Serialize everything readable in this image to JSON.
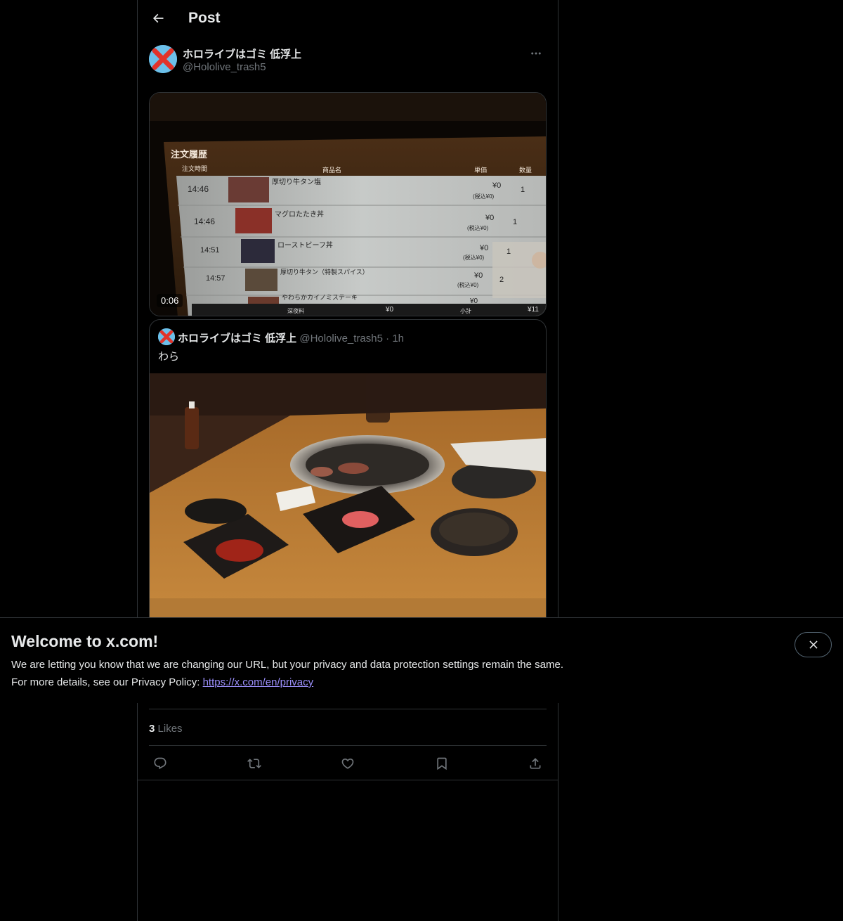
{
  "header": {
    "title": "Post"
  },
  "post": {
    "author_name": "ホロライブはゴミ 低浮上",
    "author_handle": "@Hololive_trash5",
    "video_duration": "0:06",
    "likes_count": "3",
    "likes_label": "Likes"
  },
  "quote": {
    "author_name": "ホロライブはゴミ 低浮上",
    "author_handle": "@Hololive_trash5",
    "separator": "·",
    "time": "1h",
    "text": "わら"
  },
  "video_screen": {
    "panel_title": "注文履歴",
    "col_time": "注文時間",
    "col_item": "商品名",
    "col_price": "単価",
    "col_qty": "数量",
    "rows": [
      {
        "time": "14:46",
        "item": "厚切り牛タン塩",
        "price": "¥0",
        "tax": "(税込¥0)",
        "qty": "1"
      },
      {
        "time": "14:46",
        "item": "マグロたたき丼",
        "price": "¥0",
        "tax": "(税込¥0)",
        "qty": "1"
      },
      {
        "time": "14:51",
        "item": "ローストビーフ丼",
        "price": "¥0",
        "tax": "(税込¥0)",
        "qty": "1"
      },
      {
        "time": "14:57",
        "item": "厚切り牛タン（特製スパイス）",
        "price": "¥0",
        "tax": "(税込¥0)",
        "qty": "2"
      },
      {
        "time": "",
        "item": "やわらかカイノミステーキ",
        "price": "¥0",
        "tax": "",
        "qty": ""
      }
    ],
    "footer_left": "深夜料",
    "footer_left_val": "¥0",
    "footer_right": "小計",
    "footer_right_val": "¥11"
  },
  "banner": {
    "title": "Welcome to x.com!",
    "line1": "We are letting you know that we are changing our URL, but your privacy and data protection settings remain the same.",
    "line2_prefix": "For more details, see our Privacy Policy: ",
    "link": "https://x.com/en/privacy"
  },
  "colors": {
    "background": "#000000",
    "text_primary": "#e7e9ea",
    "text_secondary": "#71767b",
    "border": "#2f3336",
    "link": "#9b8ffb"
  },
  "icons": [
    "back-arrow-icon",
    "more-icon",
    "reply-icon",
    "repost-icon",
    "like-icon",
    "bookmark-icon",
    "share-icon",
    "close-icon"
  ]
}
